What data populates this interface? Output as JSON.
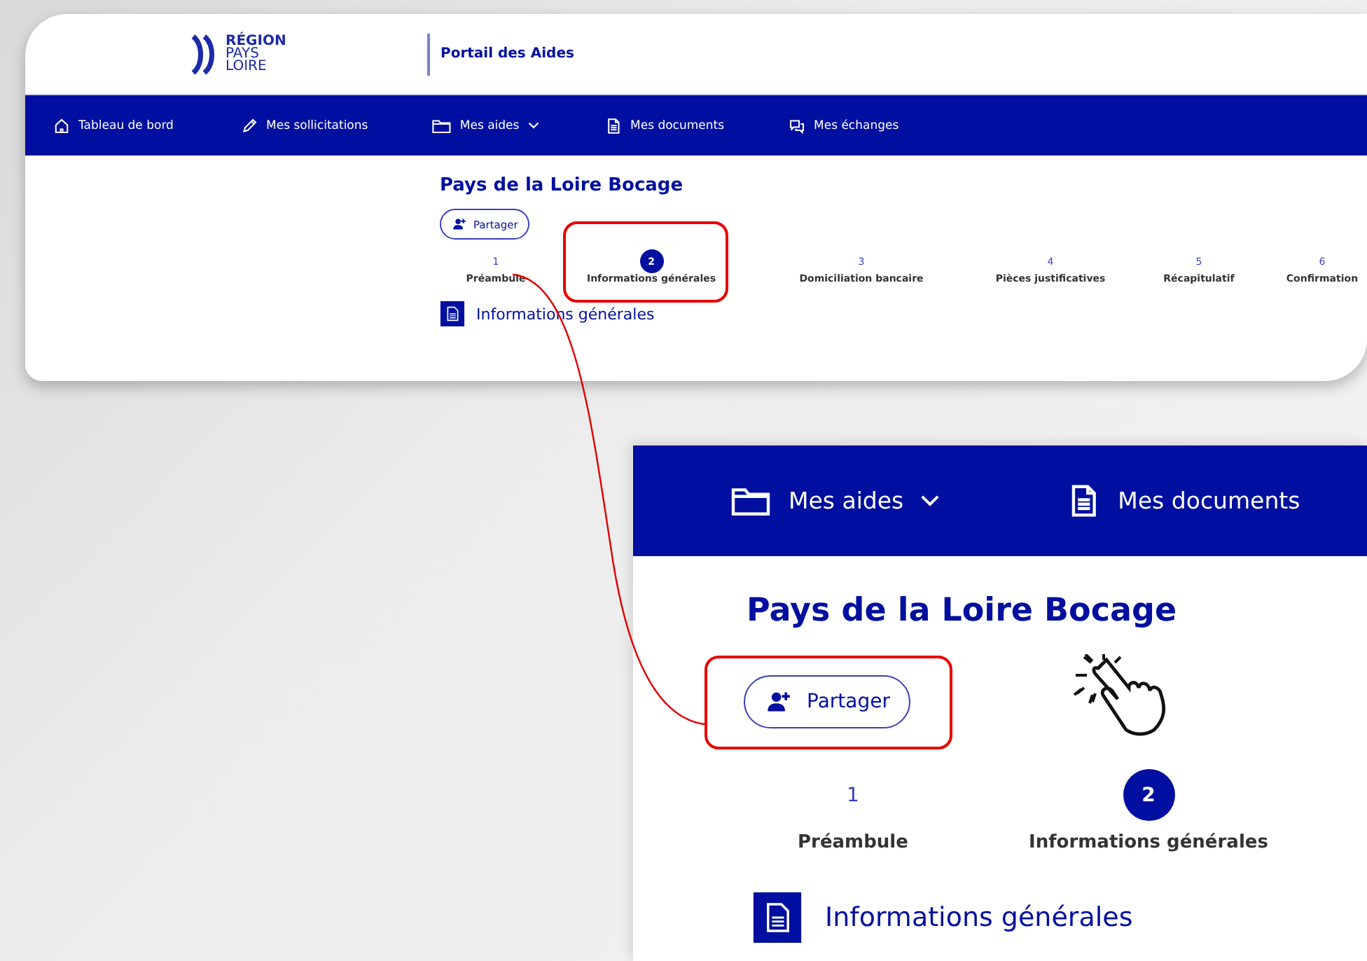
{
  "header": {
    "logo_lines": [
      "RÉGION",
      "PAYS",
      "LOIRE"
    ],
    "site_title": "Portail des Aides"
  },
  "nav": [
    {
      "label": "Tableau de bord",
      "kind": "home",
      "dropdown": false
    },
    {
      "label": "Mes sollicitations",
      "kind": "pen",
      "dropdown": false
    },
    {
      "label": "Mes aides",
      "kind": "folder",
      "dropdown": true
    },
    {
      "label": "Mes documents",
      "kind": "document",
      "dropdown": false
    },
    {
      "label": "Mes échanges",
      "kind": "chat",
      "dropdown": false
    }
  ],
  "page_title": "Pays de la Loire Bocage",
  "share_button": {
    "label": "Partager",
    "highlighted": false
  },
  "steps": [
    {
      "number": "1",
      "label": "Préambule",
      "selected": false,
      "highlighted": false
    },
    {
      "number": "2",
      "label": "Informations générales",
      "selected": true,
      "highlighted": true
    },
    {
      "number": "3",
      "label": "Domiciliation bancaire",
      "selected": false,
      "highlighted": false
    },
    {
      "number": "4",
      "label": "Pièces justificatives",
      "selected": false,
      "highlighted": false
    },
    {
      "number": "5",
      "label": "Récapitulatif",
      "selected": false,
      "highlighted": false
    },
    {
      "number": "6",
      "label": "Confirmation",
      "selected": false,
      "highlighted": false
    }
  ],
  "section_title": "Informations générales",
  "zoom_inset": {
    "nav": [
      {
        "label": "Mes aides",
        "kind": "folder",
        "dropdown": true
      },
      {
        "label": "Mes documents",
        "kind": "document",
        "dropdown": false
      }
    ],
    "page_title": "Pays de la Loire Bocage",
    "share_button": {
      "label": "Partager",
      "highlighted": true
    },
    "click_hint": true,
    "steps": [
      {
        "number": "1",
        "label": "Préambule",
        "selected": false
      },
      {
        "number": "2",
        "label": "Informations générales",
        "selected": true
      }
    ],
    "section_title": "Informations générales"
  }
}
